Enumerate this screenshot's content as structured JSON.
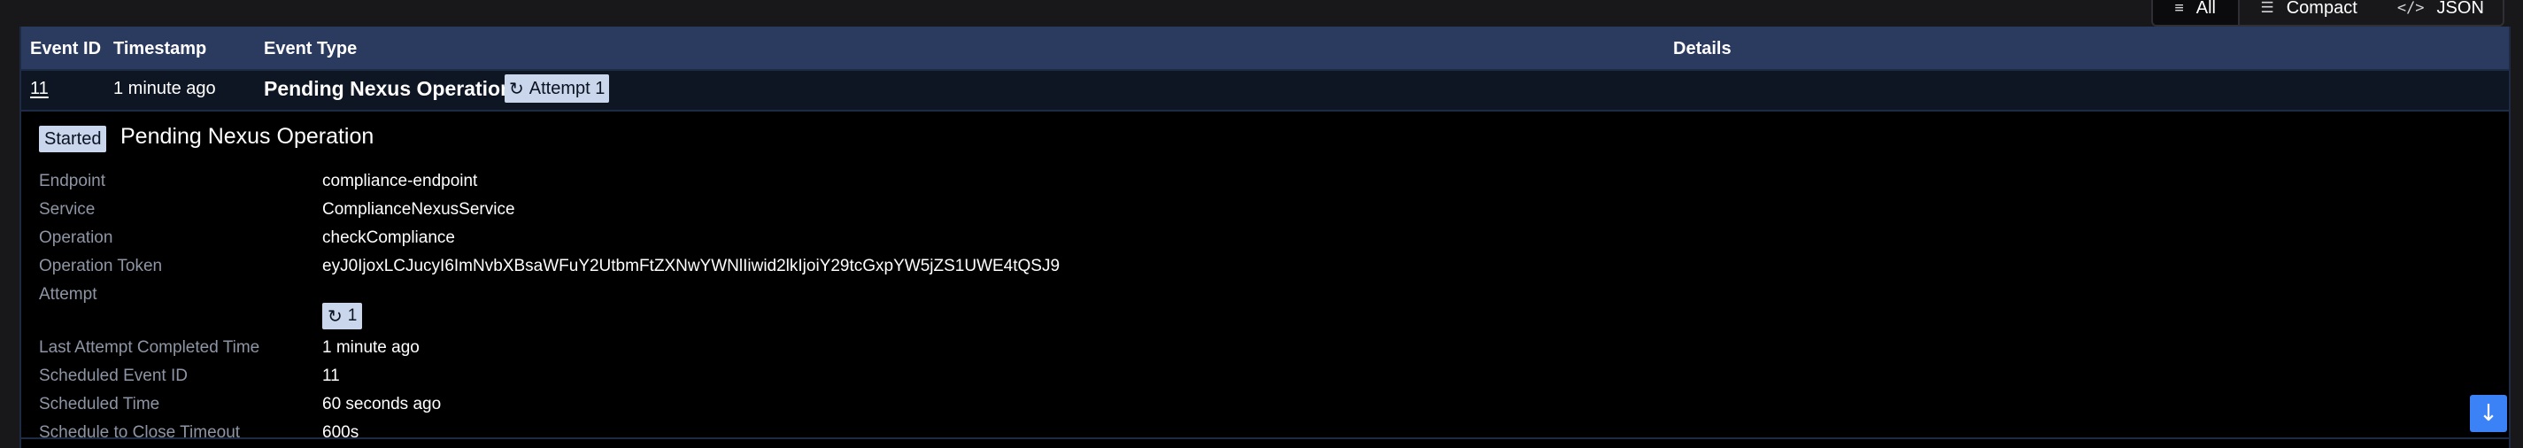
{
  "view_toggle": {
    "all": {
      "label": "All",
      "icon": "list-icon"
    },
    "compact": {
      "label": "Compact",
      "icon": "compact-list-icon"
    },
    "json": {
      "label": "JSON",
      "icon": "code-icon"
    }
  },
  "table": {
    "headers": {
      "event_id": "Event ID",
      "timestamp": "Timestamp",
      "event_type": "Event Type",
      "details": "Details"
    },
    "row": {
      "event_id": "11",
      "timestamp": "1 minute ago",
      "event_type": "Pending Nexus Operation",
      "attempt_badge": "Attempt 1"
    }
  },
  "details": {
    "status_badge": "Started",
    "title": "Pending Nexus Operation",
    "fields": [
      {
        "label": "Endpoint",
        "value": "compliance-endpoint"
      },
      {
        "label": "Service",
        "value": "ComplianceNexusService"
      },
      {
        "label": "Operation",
        "value": "checkCompliance"
      },
      {
        "label": "Operation Token",
        "value": "eyJ0IjoxLCJucyI6ImNvbXBsaWFuY2UtbmFtZXNwYWNlIiwid2lkIjoiY29tcGxpYW5jZS1UWE4tQSJ9"
      },
      {
        "label": "Attempt",
        "value": "1"
      },
      {
        "label": "Last Attempt Completed Time",
        "value": "1 minute ago"
      },
      {
        "label": "Scheduled Event ID",
        "value": "11"
      },
      {
        "label": "Scheduled Time",
        "value": "60 seconds ago"
      },
      {
        "label": "Schedule to Close Timeout",
        "value": "600s"
      }
    ]
  },
  "colors": {
    "header_bg": "#2b3a5f",
    "row_bg": "#0f1623",
    "badge_bg": "#c9d6ec",
    "label_color": "#8e95a4",
    "scroll_button": "#3b82f6"
  },
  "icons": {
    "attempt": "refresh-icon",
    "scroll": "arrow-down-icon"
  }
}
